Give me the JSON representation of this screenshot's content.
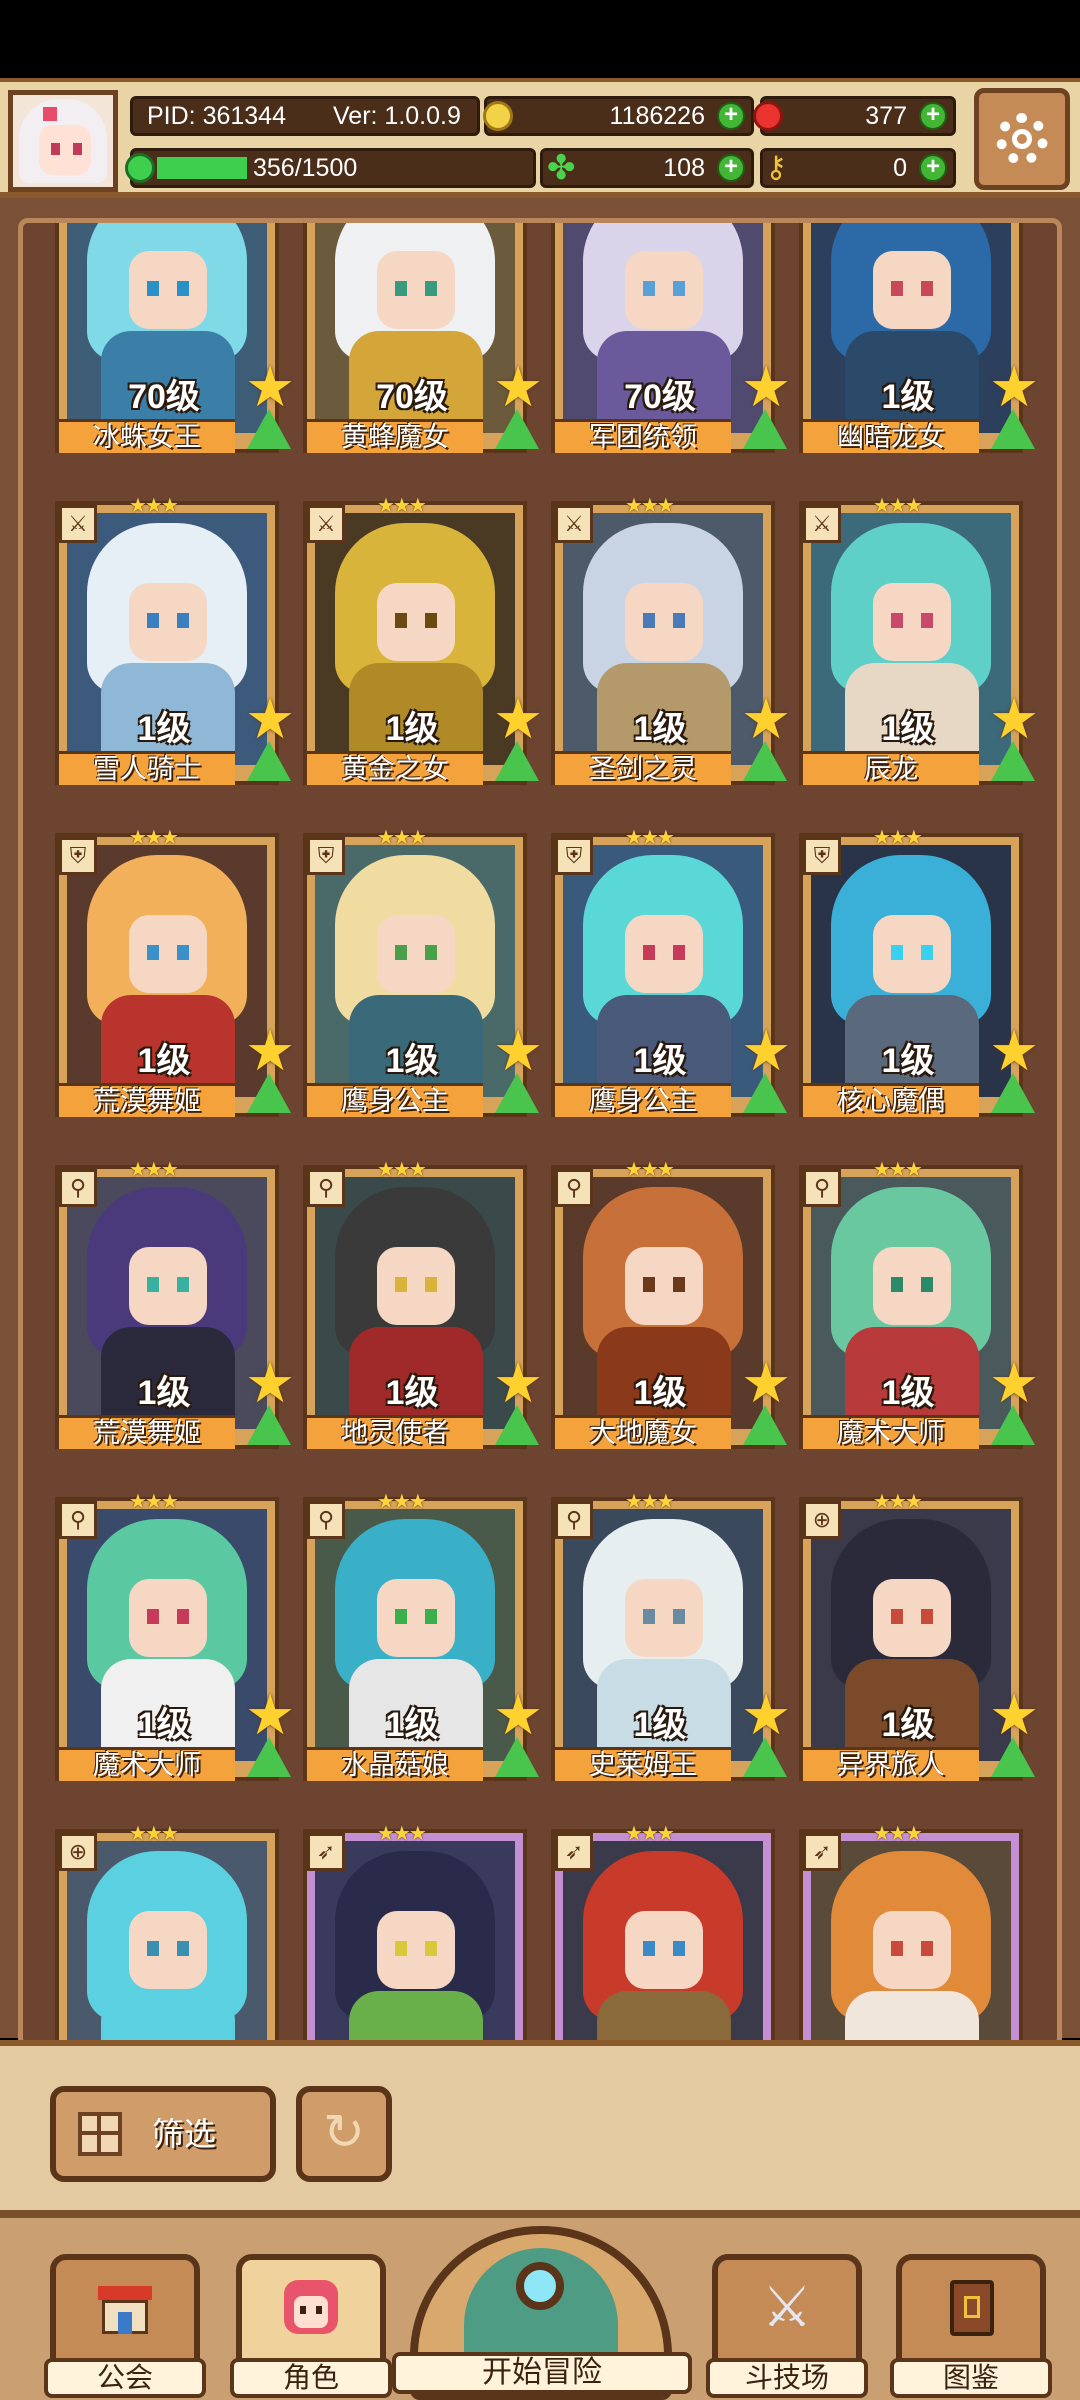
{
  "header": {
    "pid": "PID: 361344",
    "version": "Ver: 1.0.0.9",
    "gold": "1186226",
    "gems": "377",
    "exp": "356/1500",
    "exp_fraction": 0.237,
    "clover": "108",
    "tickets": "0"
  },
  "cards": [
    {
      "level": "70级",
      "name": "冰蛛女王",
      "class_icon": "shield-icon",
      "hair": "#7fd9e6",
      "body": "#3b7fa8",
      "eye": "#2a90c8",
      "bg": "#3e5d77",
      "frame": "gold"
    },
    {
      "level": "70级",
      "name": "黄蜂魔女",
      "class_icon": "shield-icon",
      "hair": "#eef0f2",
      "body": "#d4a63a",
      "eye": "#3a9a80",
      "bg": "#6b5a3c",
      "frame": "gold"
    },
    {
      "level": "70级",
      "name": "军团统领",
      "class_icon": "sword-icon",
      "hair": "#d9d4ea",
      "body": "#6a5a9c",
      "eye": "#5aa0d8",
      "bg": "#4f4a6e",
      "frame": "gold"
    },
    {
      "level": "1级",
      "name": "幽暗龙女",
      "class_icon": "sword-icon",
      "hair": "#2b6aa6",
      "body": "#2b4a6a",
      "eye": "#c84a5a",
      "bg": "#2c3f5c",
      "frame": "gold"
    },
    {
      "level": "1级",
      "name": "雪人骑士",
      "class_icon": "sword-icon",
      "hair": "#e6eef6",
      "body": "#8fb8d6",
      "eye": "#3a80c0",
      "bg": "#3c5a7c",
      "frame": "gold"
    },
    {
      "level": "1级",
      "name": "黄金之女",
      "class_icon": "sword-icon",
      "hair": "#d8b43a",
      "body": "#b08a26",
      "eye": "#6a4a10",
      "bg": "#4a3a24",
      "frame": "gold"
    },
    {
      "level": "1级",
      "name": "圣剑之灵",
      "class_icon": "sword-icon",
      "hair": "#c8d4e4",
      "body": "#b49a6a",
      "eye": "#4a7ab8",
      "bg": "#4c5a6a",
      "frame": "gold"
    },
    {
      "level": "1级",
      "name": "辰龙",
      "class_icon": "sword-icon",
      "hair": "#5fd0c8",
      "body": "#e6d8c4",
      "eye": "#c84a6a",
      "bg": "#3c6a7a",
      "frame": "gold"
    },
    {
      "level": "1级",
      "name": "荒漠舞姬",
      "class_icon": "shield-icon",
      "hair": "#f2b05a",
      "body": "#b8342c",
      "eye": "#3a90c8",
      "bg": "#5a3a2c",
      "frame": "gold"
    },
    {
      "level": "1级",
      "name": "鹰身公主",
      "class_icon": "shield-icon",
      "hair": "#f0dca0",
      "body": "#3a6a7a",
      "eye": "#4aa04a",
      "bg": "#4a6a6a",
      "frame": "gold"
    },
    {
      "level": "1级",
      "name": "鹰身公主",
      "class_icon": "shield-icon",
      "hair": "#5ad8d8",
      "body": "#4a5a7a",
      "eye": "#c83a5a",
      "bg": "#3a5a7c",
      "frame": "gold"
    },
    {
      "level": "1级",
      "name": "核心魔偶",
      "class_icon": "shield-icon",
      "hair": "#3ab0d8",
      "body": "#5a6a7c",
      "eye": "#3ad0f0",
      "bg": "#2a3448",
      "frame": "gold"
    },
    {
      "level": "1级",
      "name": "荒漠舞姬",
      "class_icon": "staff-icon",
      "hair": "#4a3a7c",
      "body": "#2a2a3c",
      "eye": "#3ab0a0",
      "bg": "#4a4a5c",
      "frame": "gold"
    },
    {
      "level": "1级",
      "name": "地灵使者",
      "class_icon": "staff-icon",
      "hair": "#3a3a3a",
      "body": "#a02a2a",
      "eye": "#d8b43a",
      "bg": "#3a4a4a",
      "frame": "gold"
    },
    {
      "level": "1级",
      "name": "大地魔女",
      "class_icon": "staff-icon",
      "hair": "#c8703a",
      "body": "#8a3a1a",
      "eye": "#6a3a1a",
      "bg": "#5a3a2a",
      "frame": "gold"
    },
    {
      "level": "1级",
      "name": "魔术大师",
      "class_icon": "staff-icon",
      "hair": "#6ac8a0",
      "body": "#b83a3a",
      "eye": "#2a8a6a",
      "bg": "#4a5a5c",
      "frame": "gold"
    },
    {
      "level": "1级",
      "name": "魔术大师",
      "class_icon": "staff-icon",
      "hair": "#5ac8a0",
      "body": "#f0f0f0",
      "eye": "#c83a5a",
      "bg": "#3a4a6a",
      "frame": "gold"
    },
    {
      "level": "1级",
      "name": "水晶菇娘",
      "class_icon": "staff-icon",
      "hair": "#3ab0c8",
      "body": "#e6e6e6",
      "eye": "#3ab04a",
      "bg": "#4a5a4a",
      "frame": "gold"
    },
    {
      "level": "1级",
      "name": "史莱姆王",
      "class_icon": "staff-icon",
      "hair": "#e6eef0",
      "body": "#c8dce6",
      "eye": "#6a8aa0",
      "bg": "#3a4a5c",
      "frame": "gold"
    },
    {
      "level": "1级",
      "name": "异界旅人",
      "class_icon": "target-icon",
      "hair": "#2a2a3a",
      "body": "#7a4a2a",
      "eye": "#c84a3a",
      "bg": "#3a3a4a",
      "frame": "gold"
    },
    {
      "level": "",
      "name": "",
      "class_icon": "target-icon",
      "hair": "#5ad0e0",
      "body": "#5ad0e0",
      "eye": "#3a90b0",
      "bg": "#4a5a6c",
      "frame": "gold"
    },
    {
      "level": "",
      "name": "",
      "class_icon": "bow-icon",
      "hair": "#2a2a4a",
      "body": "#6ab04a",
      "eye": "#d8c83a",
      "bg": "#3a3a5c",
      "frame": "purple"
    },
    {
      "level": "",
      "name": "",
      "class_icon": "bow-icon",
      "hair": "#c83a2a",
      "body": "#8a6a3a",
      "eye": "#3a8ac8",
      "bg": "#3a3a4a",
      "frame": "purple"
    },
    {
      "level": "",
      "name": "",
      "class_icon": "bow-icon",
      "hair": "#e08a3a",
      "body": "#f0e6dc",
      "eye": "#c84a3a",
      "bg": "#5a4a3a",
      "frame": "purple"
    }
  ],
  "filter": {
    "label": "筛选"
  },
  "nav": {
    "guild": "公会",
    "role": "角色",
    "adventure": "开始冒险",
    "arena": "斗技场",
    "codex": "图鉴"
  },
  "colors": {
    "accent": "#f4a23b",
    "plus_green": "#43b636",
    "frame_dark": "#5a3519"
  }
}
